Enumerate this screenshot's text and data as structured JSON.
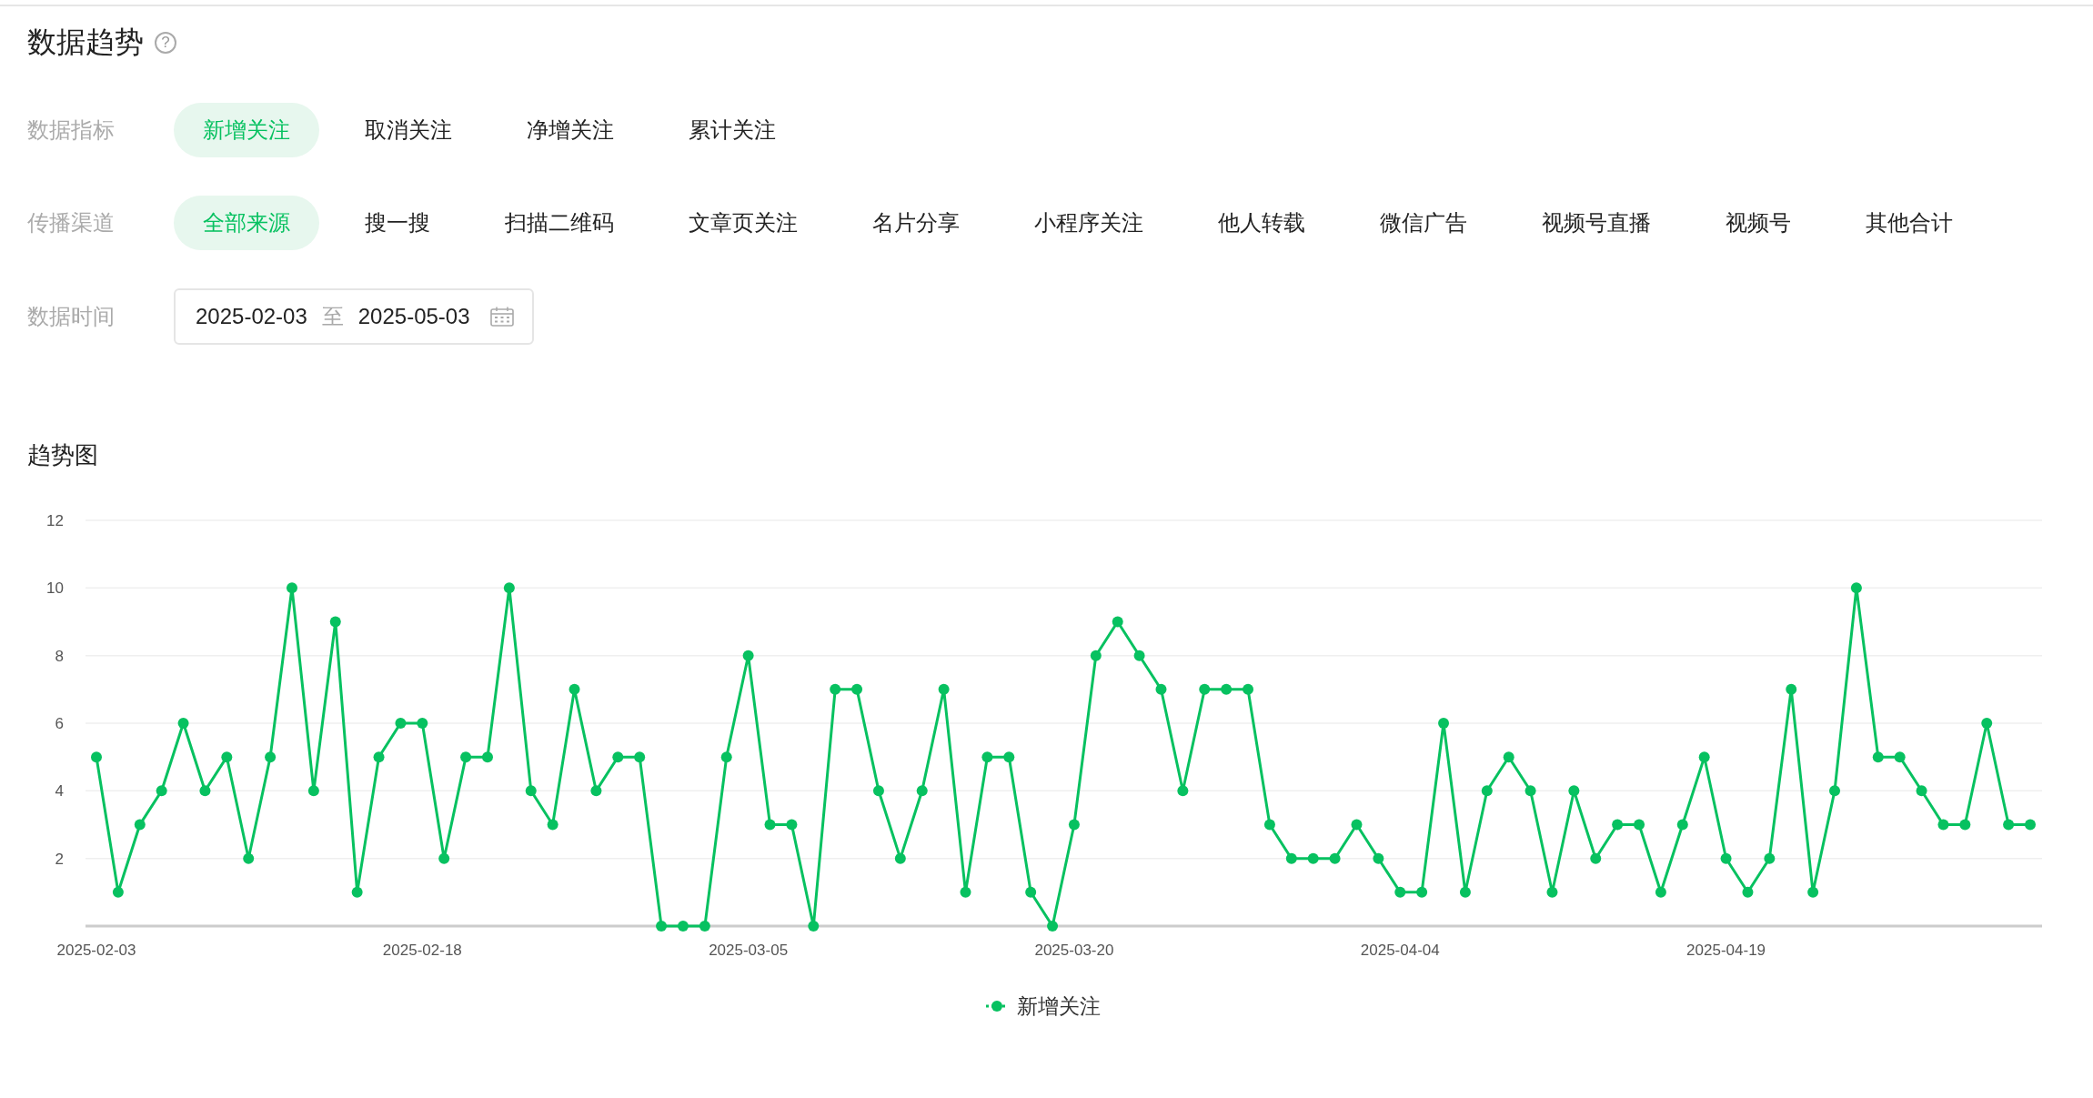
{
  "header": {
    "title": "数据趋势",
    "help": "?"
  },
  "filters": [
    {
      "label": "数据指标",
      "options": [
        {
          "label": "新增关注",
          "selected": true
        },
        {
          "label": "取消关注",
          "selected": false
        },
        {
          "label": "净增关注",
          "selected": false
        },
        {
          "label": "累计关注",
          "selected": false
        }
      ]
    },
    {
      "label": "传播渠道",
      "options": [
        {
          "label": "全部来源",
          "selected": true
        },
        {
          "label": "搜一搜",
          "selected": false
        },
        {
          "label": "扫描二维码",
          "selected": false
        },
        {
          "label": "文章页关注",
          "selected": false
        },
        {
          "label": "名片分享",
          "selected": false
        },
        {
          "label": "小程序关注",
          "selected": false
        },
        {
          "label": "他人转载",
          "selected": false
        },
        {
          "label": "微信广告",
          "selected": false
        },
        {
          "label": "视频号直播",
          "selected": false
        },
        {
          "label": "视频号",
          "selected": false
        },
        {
          "label": "其他合计",
          "selected": false
        }
      ]
    }
  ],
  "date_range": {
    "label": "数据时间",
    "start": "2025-02-03",
    "separator": "至",
    "end": "2025-05-03"
  },
  "chart_section": {
    "title": "趋势图",
    "chart_data": {
      "type": "line",
      "grid": true,
      "categories": [
        "2025-02-03",
        null,
        null,
        null,
        null,
        null,
        null,
        null,
        null,
        null,
        null,
        null,
        null,
        null,
        null,
        "2025-02-18",
        null,
        null,
        null,
        null,
        null,
        null,
        null,
        null,
        null,
        null,
        null,
        null,
        null,
        null,
        "2025-03-05",
        null,
        null,
        null,
        null,
        null,
        null,
        null,
        null,
        null,
        null,
        null,
        null,
        null,
        null,
        "2025-03-20",
        null,
        null,
        null,
        null,
        null,
        null,
        null,
        null,
        null,
        null,
        null,
        null,
        null,
        null,
        "2025-04-04",
        null,
        null,
        null,
        null,
        null,
        null,
        null,
        null,
        null,
        null,
        null,
        null,
        null,
        null,
        "2025-04-19",
        null,
        null,
        null,
        null,
        null,
        null,
        null,
        null,
        null,
        null,
        null,
        null,
        null,
        null
      ],
      "series": [
        {
          "name": "新增关注",
          "color": "#07c160",
          "marker": "circle",
          "values": [
            5,
            1,
            3,
            4,
            6,
            4,
            5,
            2,
            5,
            10,
            4,
            9,
            1,
            5,
            6,
            6,
            2,
            5,
            5,
            10,
            4,
            3,
            7,
            4,
            5,
            5,
            0,
            0,
            0,
            5,
            8,
            3,
            3,
            0,
            7,
            7,
            4,
            2,
            4,
            7,
            1,
            5,
            5,
            1,
            0,
            3,
            8,
            9,
            8,
            7,
            4,
            7,
            7,
            7,
            3,
            2,
            2,
            2,
            3,
            2,
            1,
            1,
            6,
            1,
            4,
            5,
            4,
            1,
            4,
            2,
            3,
            3,
            1,
            3,
            5,
            2,
            1,
            2,
            7,
            1,
            4,
            10,
            5,
            5,
            4,
            3,
            3,
            6,
            3,
            3
          ]
        }
      ],
      "ylim": [
        0,
        12
      ],
      "yticks": [
        2,
        4,
        6,
        8,
        10,
        12
      ]
    }
  }
}
